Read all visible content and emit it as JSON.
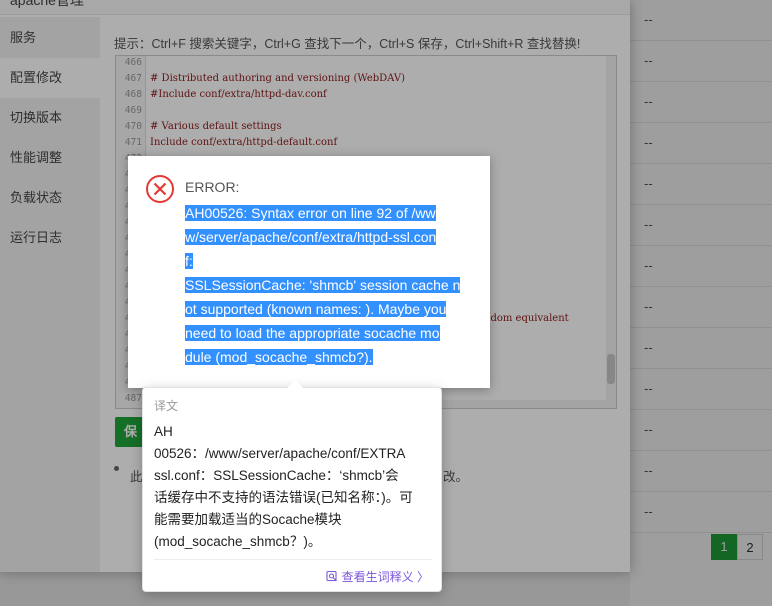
{
  "background_table": {
    "dashes": [
      "--",
      "--",
      "--",
      "--",
      "--",
      "--",
      "--",
      "--",
      "--",
      "--",
      "--",
      "--",
      "--"
    ]
  },
  "pager": {
    "pages": [
      "1",
      "2"
    ],
    "active": "1"
  },
  "dialog": {
    "title": "apache管理",
    "nav": [
      "服务",
      "配置修改",
      "切换版本",
      "性能调整",
      "负载状态",
      "运行日志"
    ],
    "active_nav": "配置修改",
    "hint": "提示：Ctrl+F 搜索关键字，Ctrl+G 查找下一个，Ctrl+S 保存，Ctrl+Shift+R 查找替换!",
    "editor": {
      "lines": [
        {
          "num": "466",
          "text": ""
        },
        {
          "num": "467",
          "text": "# Distributed authoring and versioning (WebDAV)"
        },
        {
          "num": "468",
          "text": "#Include conf/extra/httpd-dav.conf"
        },
        {
          "num": "469",
          "text": ""
        },
        {
          "num": "470",
          "text": "# Various default settings"
        },
        {
          "num": "471",
          "text": "Include conf/extra/httpd-default.conf"
        },
        {
          "num": "472",
          "text": ""
        },
        {
          "num": "473",
          "text": ""
        },
        {
          "num": "474",
          "text": ""
        },
        {
          "num": "475",
          "text": ""
        },
        {
          "num": "476",
          "text": ""
        },
        {
          "num": "477",
          "text": ""
        },
        {
          "num": "478",
          "text": ""
        },
        {
          "num": "479",
          "text": ""
        },
        {
          "num": "480",
          "text": ""
        },
        {
          "num": "481",
          "text": ""
        },
        {
          "num": "482",
          "text": "ndom equivalent"
        },
        {
          "num": "483",
          "text": ""
        },
        {
          "num": "484",
          "text": ""
        },
        {
          "num": "485",
          "text": ""
        },
        {
          "num": "486",
          "text": ""
        },
        {
          "num": "487",
          "text": ""
        }
      ]
    },
    "save_label": "保存",
    "note_left": "此",
    "note_right": "改。"
  },
  "error": {
    "title": "ERROR:",
    "message_lines": [
      "AH00526: Syntax error on line 92 of /ww",
      "w/server/apache/conf/extra/httpd-ssl.con",
      "f:",
      "SSLSessionCache: 'shmcb' session cache n",
      "ot supported (known names: ). Maybe you",
      "need to load the appropriate socache mo",
      "dule (mod_socache_shmcb?)."
    ],
    "icon": "close-circle-icon",
    "icon_color": "#e53935"
  },
  "translation": {
    "label": "译文",
    "text": "AH\n00526：/www/server/apache/conf/EXTRA\nssl.conf：SSLSessionCache：‘shmcb’会\n话缓存中不支持的语法错误(已知名称：)。可\n能需要加载适当的Socache模块\n(mod_socache_shmcb？)。",
    "link": "查看生词释义 〉",
    "link_icon": "book-icon",
    "link_color": "#7b57d9"
  },
  "colors": {
    "accent": "#20a53a",
    "selection": "#3390ff"
  }
}
